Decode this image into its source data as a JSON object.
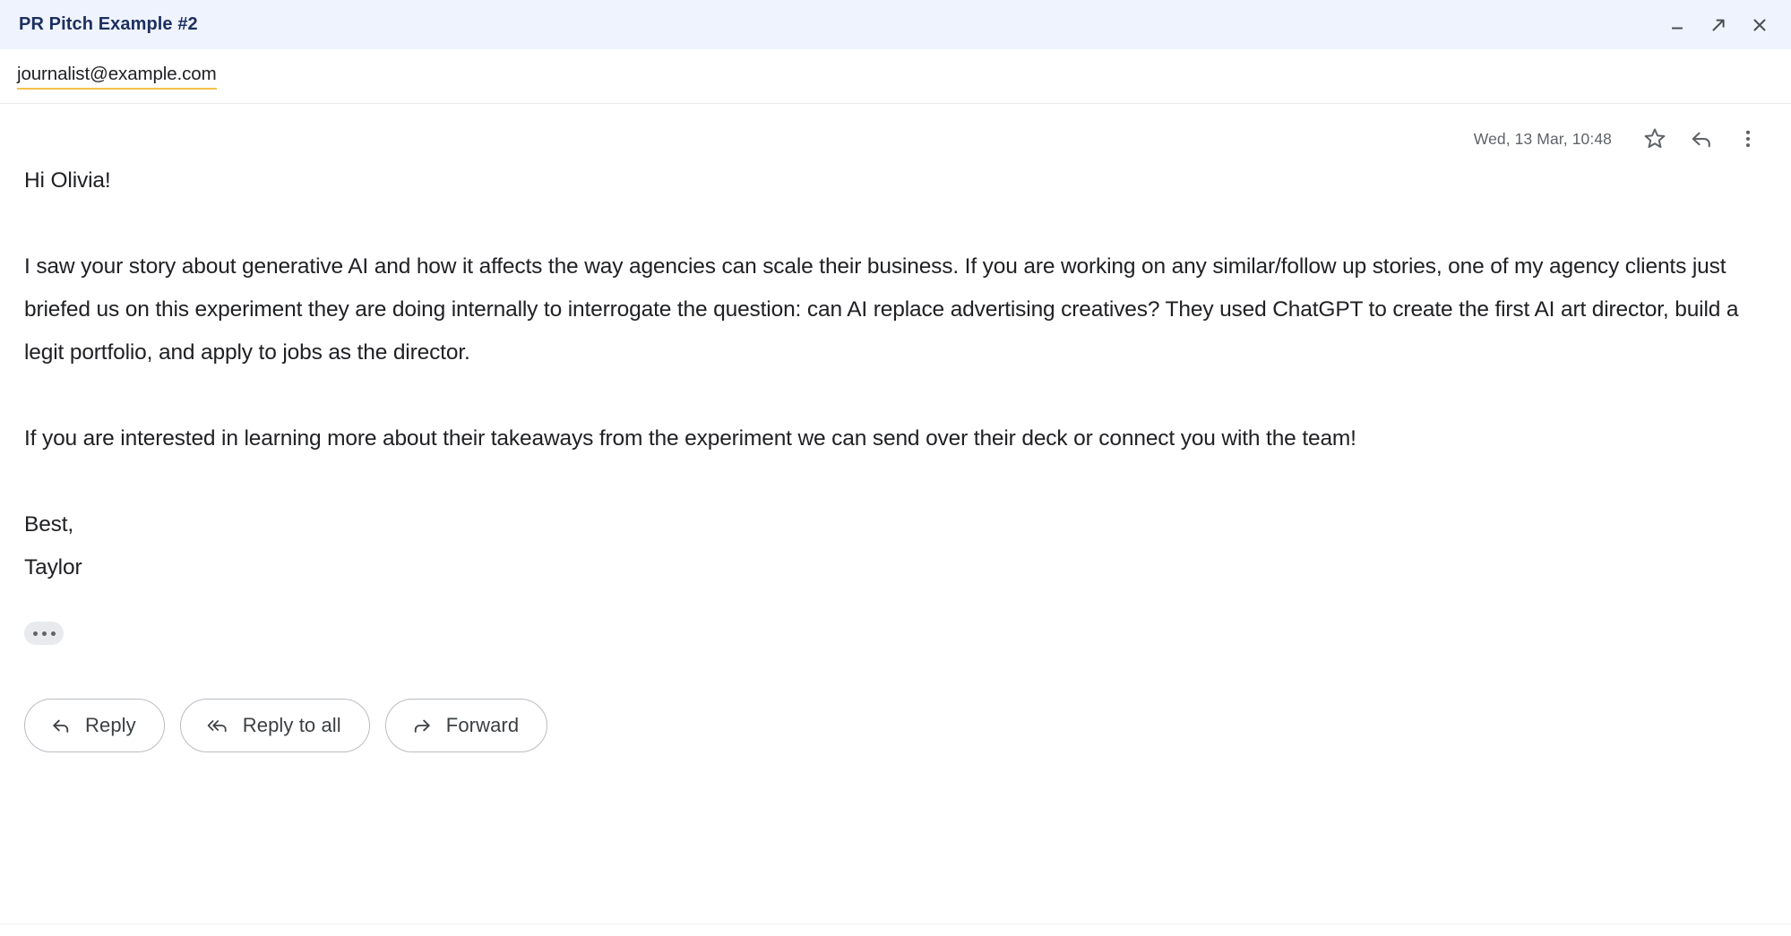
{
  "window": {
    "title": "PR Pitch Example #2",
    "controls": [
      {
        "name": "minimize",
        "icon": "minimize-icon"
      },
      {
        "name": "expand",
        "icon": "expand-icon"
      },
      {
        "name": "close",
        "icon": "close-icon"
      }
    ],
    "accent_header_bg": "#eff3fd",
    "title_color": "#1c2f5e"
  },
  "recipient": {
    "address": "journalist@example.com",
    "underline_color": "#f4c04a"
  },
  "meta": {
    "date": "Wed, 13 Mar, 10:48",
    "actions": [
      {
        "name": "star",
        "icon": "star-icon"
      },
      {
        "name": "reply",
        "icon": "reply-arrow-icon"
      },
      {
        "name": "more",
        "icon": "more-vertical-icon"
      }
    ]
  },
  "message": {
    "greeting": "Hi Olivia!",
    "paragraph1": "I saw your story about generative AI and how it affects the way agencies can scale their business. If you are working on any similar/follow up stories, one of my agency clients just briefed us on this experiment they are doing internally to interrogate the question: can AI replace advertising creatives? They used ChatGPT to create the first AI art director, build a legit portfolio, and apply to jobs as the director.",
    "paragraph2": "If you are interested in learning more about their takeaways from the experiment we can send over their deck or connect you with the team!",
    "signoff": "Best,",
    "signature": "Taylor",
    "trimmed_label": "Show trimmed content"
  },
  "footer": {
    "buttons": [
      {
        "label": "Reply",
        "icon": "reply-icon"
      },
      {
        "label": "Reply to all",
        "icon": "reply-all-icon"
      },
      {
        "label": "Forward",
        "icon": "forward-icon"
      }
    ]
  }
}
